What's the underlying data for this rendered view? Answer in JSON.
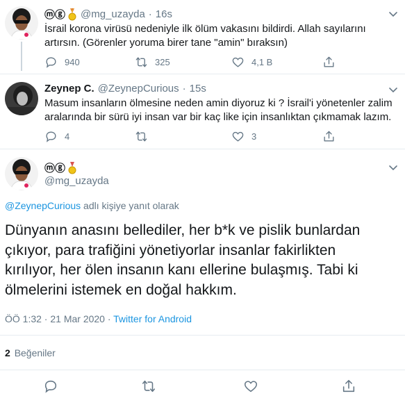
{
  "tweet1": {
    "display_name": "ⓜⓖ",
    "handle": "@mg_uzayda",
    "separator": "·",
    "time": "16s",
    "text_line1": "İsrail korona virüsü nedeniyle ilk ölüm vakasını bildirdi. Allah sayılarını",
    "text_line2": "artırsın. (Görenler yoruma birer tane \"amin\" bıraksın)",
    "replies": "940",
    "retweets": "325",
    "likes": "4,1 B"
  },
  "tweet2": {
    "display_name": "Zeynep C.",
    "handle": "@ZeynepCurious",
    "separator": "·",
    "time": "15s",
    "text_line1": "Masum insanların ölmesine neden amin diyoruz ki ? İsrail'i yönetenler zalim",
    "text_line2": "aralarında bir sürü iyi insan var bir kaç like için insanlıktan çıkmamak lazım.",
    "replies": "4",
    "retweets": "",
    "likes": "3"
  },
  "main_tweet": {
    "display_name": "ⓜⓖ",
    "handle": "@mg_uzayda",
    "reply_to_handle": "@ZeynepCurious",
    "reply_to_suffix": "adlı kişiye yanıt olarak",
    "text_line1": "Dünyanın anasını bellediler, her b*k ve pislik bunlardan",
    "text_line2": "çıkıyor, para trafiğini yönetiyorlar insanlar fakirlikten",
    "text_line3": "kırılıyor, her ölen insanın kanı ellerine bulaşmış. Tabi ki",
    "text_line4": "ölmelerini istemek en doğal hakkım.",
    "timestamp": "ÖÖ 1:32 · 21 Mar 2020 · ",
    "source": "Twitter for Android",
    "likes_count": "2",
    "likes_label": "Beğeniler"
  },
  "colors": {
    "text": "#14171a",
    "muted": "#657786",
    "link": "#1b95e0",
    "divider": "#e6ecf0"
  }
}
